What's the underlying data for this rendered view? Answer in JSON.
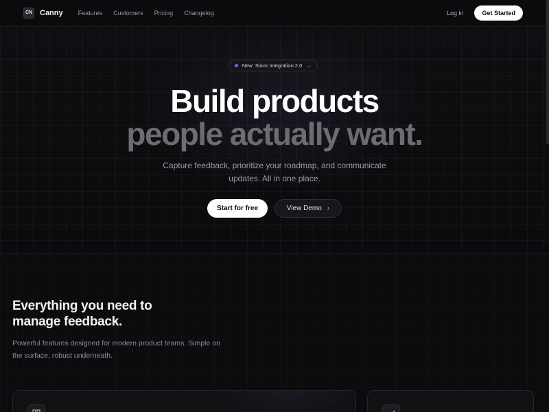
{
  "nav": {
    "logo_mark": "CN",
    "brand": "Canny",
    "links": [
      "Features",
      "Customers",
      "Pricing",
      "Changelog"
    ],
    "login": "Log in",
    "cta": "Get Started"
  },
  "hero": {
    "badge": "New: Slack Integration 2.0",
    "badge_arrow": "→",
    "title_line1": "Build products",
    "title_line2": "people actually want.",
    "subtitle_line1": "Capture feedback, prioritize your roadmap, and communicate",
    "subtitle_line2": "updates. All in one place.",
    "primary_cta": "Start for free",
    "secondary_cta": "View Demo",
    "secondary_chevron": "›"
  },
  "features": {
    "title_line1": "Everything you need to",
    "title_line2": "manage feedback.",
    "subtitle_line1": "Powerful features designed for modern product teams. Simple on",
    "subtitle_line2": "the surface, robust underneath.",
    "card_icons": [
      "grid-icon",
      "chart-icon"
    ]
  },
  "colors": {
    "background": "#0b0b0d",
    "accent": "#6c6cf0",
    "muted_title": "#6c6c72"
  }
}
